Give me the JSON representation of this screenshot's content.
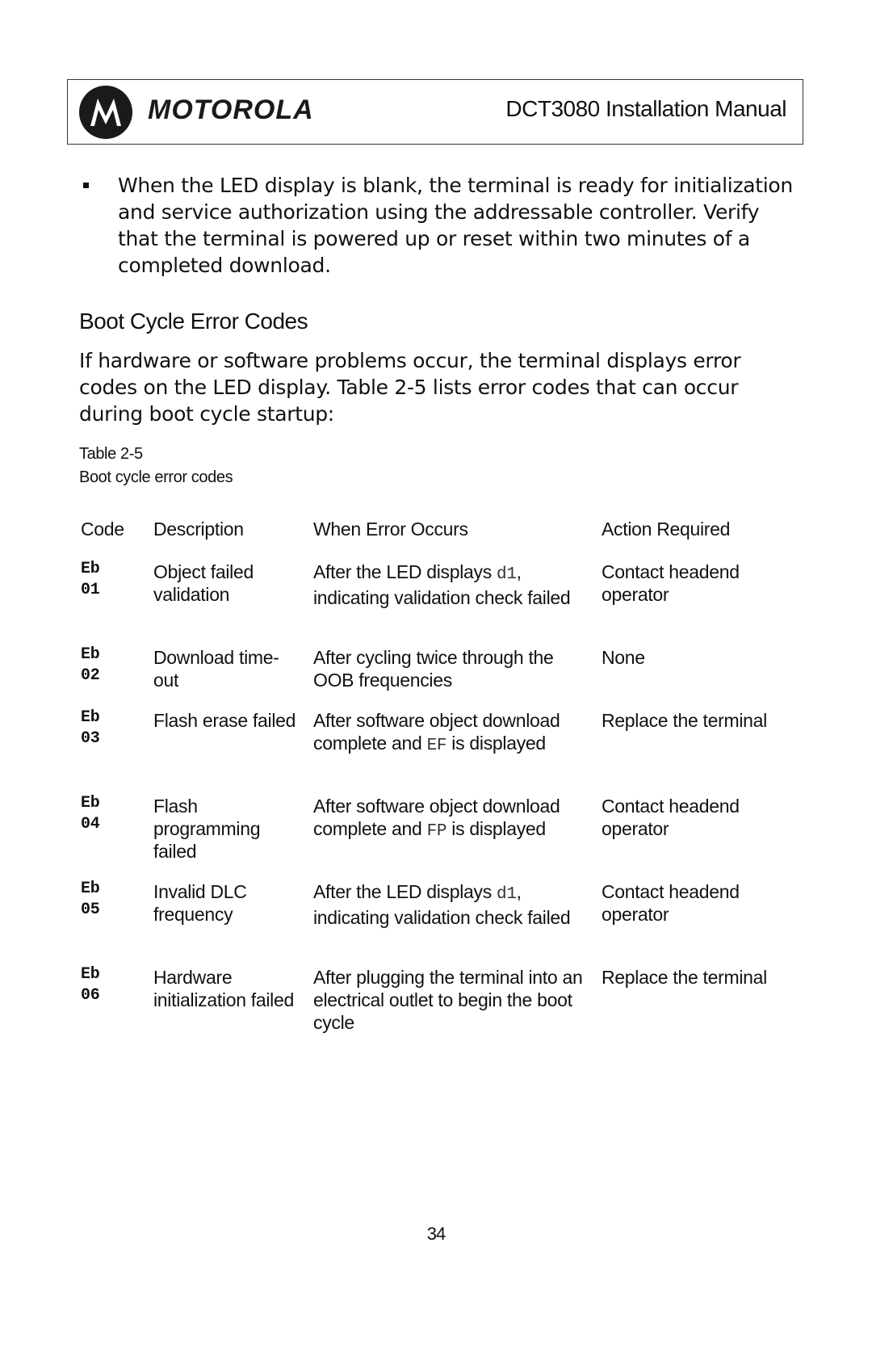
{
  "header": {
    "brand": "MOTOROLA",
    "logo_icon": "motorola-batwing-logo",
    "manual_title": "DCT3080 Installation Manual"
  },
  "bullet": {
    "icon": "square-bullet",
    "text": "When the LED display is blank, the terminal is ready for initialization and service authorization using the addressable controller. Verify that the terminal is powered up or reset within two minutes of a completed download."
  },
  "section": {
    "heading": "Boot Cycle Error Codes",
    "paragraph": "If hardware or software problems occur, the terminal displays error codes on the LED display. Table 2-5 lists error codes that can occur during boot cycle startup:"
  },
  "table": {
    "number": "Table 2-5",
    "caption": "Boot cycle error codes",
    "headers": [
      "Code",
      "Description",
      "When Error Occurs",
      "Action Required"
    ],
    "rows": [
      {
        "code_line1": "Eb",
        "code_line2": "01",
        "description": "Object failed validation",
        "when_pre": "After the LED displays ",
        "when_code": "d1",
        "when_post": ", indicating validation check failed",
        "action": "Contact headend operator"
      },
      {
        "code_line1": "Eb",
        "code_line2": "02",
        "description": "Download time-out",
        "when_pre": "After cycling twice through the OOB frequencies",
        "when_code": "",
        "when_post": "",
        "action": "None"
      },
      {
        "code_line1": "Eb",
        "code_line2": "03",
        "description": "Flash erase failed",
        "when_pre": "After software object download complete and ",
        "when_code": "EF",
        "when_post": " is displayed",
        "action": "Replace the terminal"
      },
      {
        "code_line1": "Eb",
        "code_line2": "04",
        "description": "Flash programming failed",
        "when_pre": "After software object download complete and ",
        "when_code": "FP",
        "when_post": " is displayed",
        "action": "Contact headend operator"
      },
      {
        "code_line1": "Eb",
        "code_line2": "05",
        "description": "Invalid DLC frequency",
        "when_pre": "After the LED displays ",
        "when_code": "d1",
        "when_post": ", indicating validation check failed",
        "action": "Contact headend operator"
      },
      {
        "code_line1": "Eb",
        "code_line2": "06",
        "description": "Hardware initialization failed",
        "when_pre": "After plugging the terminal into an electrical outlet to begin the boot cycle",
        "when_code": "",
        "when_post": "",
        "action": "Replace the terminal"
      }
    ]
  },
  "footer": {
    "page_number": "34"
  }
}
